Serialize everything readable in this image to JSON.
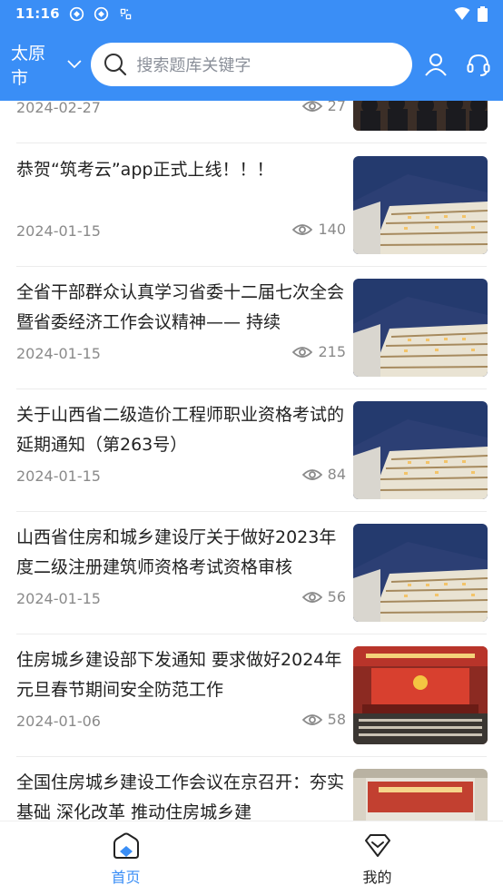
{
  "status_bar": {
    "time": "11:16"
  },
  "header": {
    "city": "太原市",
    "search_placeholder": "搜索题库关键字"
  },
  "articles": [
    {
      "title": "",
      "date": "2024-02-27",
      "views": "27",
      "thumb": "meeting-photo"
    },
    {
      "title": "恭贺“筑考云”app正式上线！！！",
      "date": "2024-01-15",
      "views": "140",
      "thumb": "campus-night-photo"
    },
    {
      "title": "全省干部群众认真学习省委十二届七次全会暨省委经济工作会议精神—— 持续",
      "date": "2024-01-15",
      "views": "215",
      "thumb": "campus-night-photo"
    },
    {
      "title": "关于山西省二级造价工程师职业资格考试的延期通知（第263号）",
      "date": "2024-01-15",
      "views": "84",
      "thumb": "campus-night-photo"
    },
    {
      "title": "山西省住房和城乡建设厅关于做好2023年度二级注册建筑师资格考试资格审核",
      "date": "2024-01-15",
      "views": "56",
      "thumb": "campus-night-photo"
    },
    {
      "title": "住房城乡建设部下发通知 要求做好2024年元旦春节期间安全防范工作",
      "date": "2024-01-06",
      "views": "58",
      "thumb": "conference-hall-photo"
    },
    {
      "title": "全国住房城乡建设工作会议在京召开：夯实基础 深化改革 推动住房城乡建",
      "date": "",
      "views": "",
      "thumb": "conference-hall-photo"
    }
  ],
  "tabbar": {
    "home_label": "首页",
    "mine_label": "我的"
  },
  "colors": {
    "brand": "#3a8ef6",
    "text": "#222222",
    "muted": "#8a8a8a"
  }
}
